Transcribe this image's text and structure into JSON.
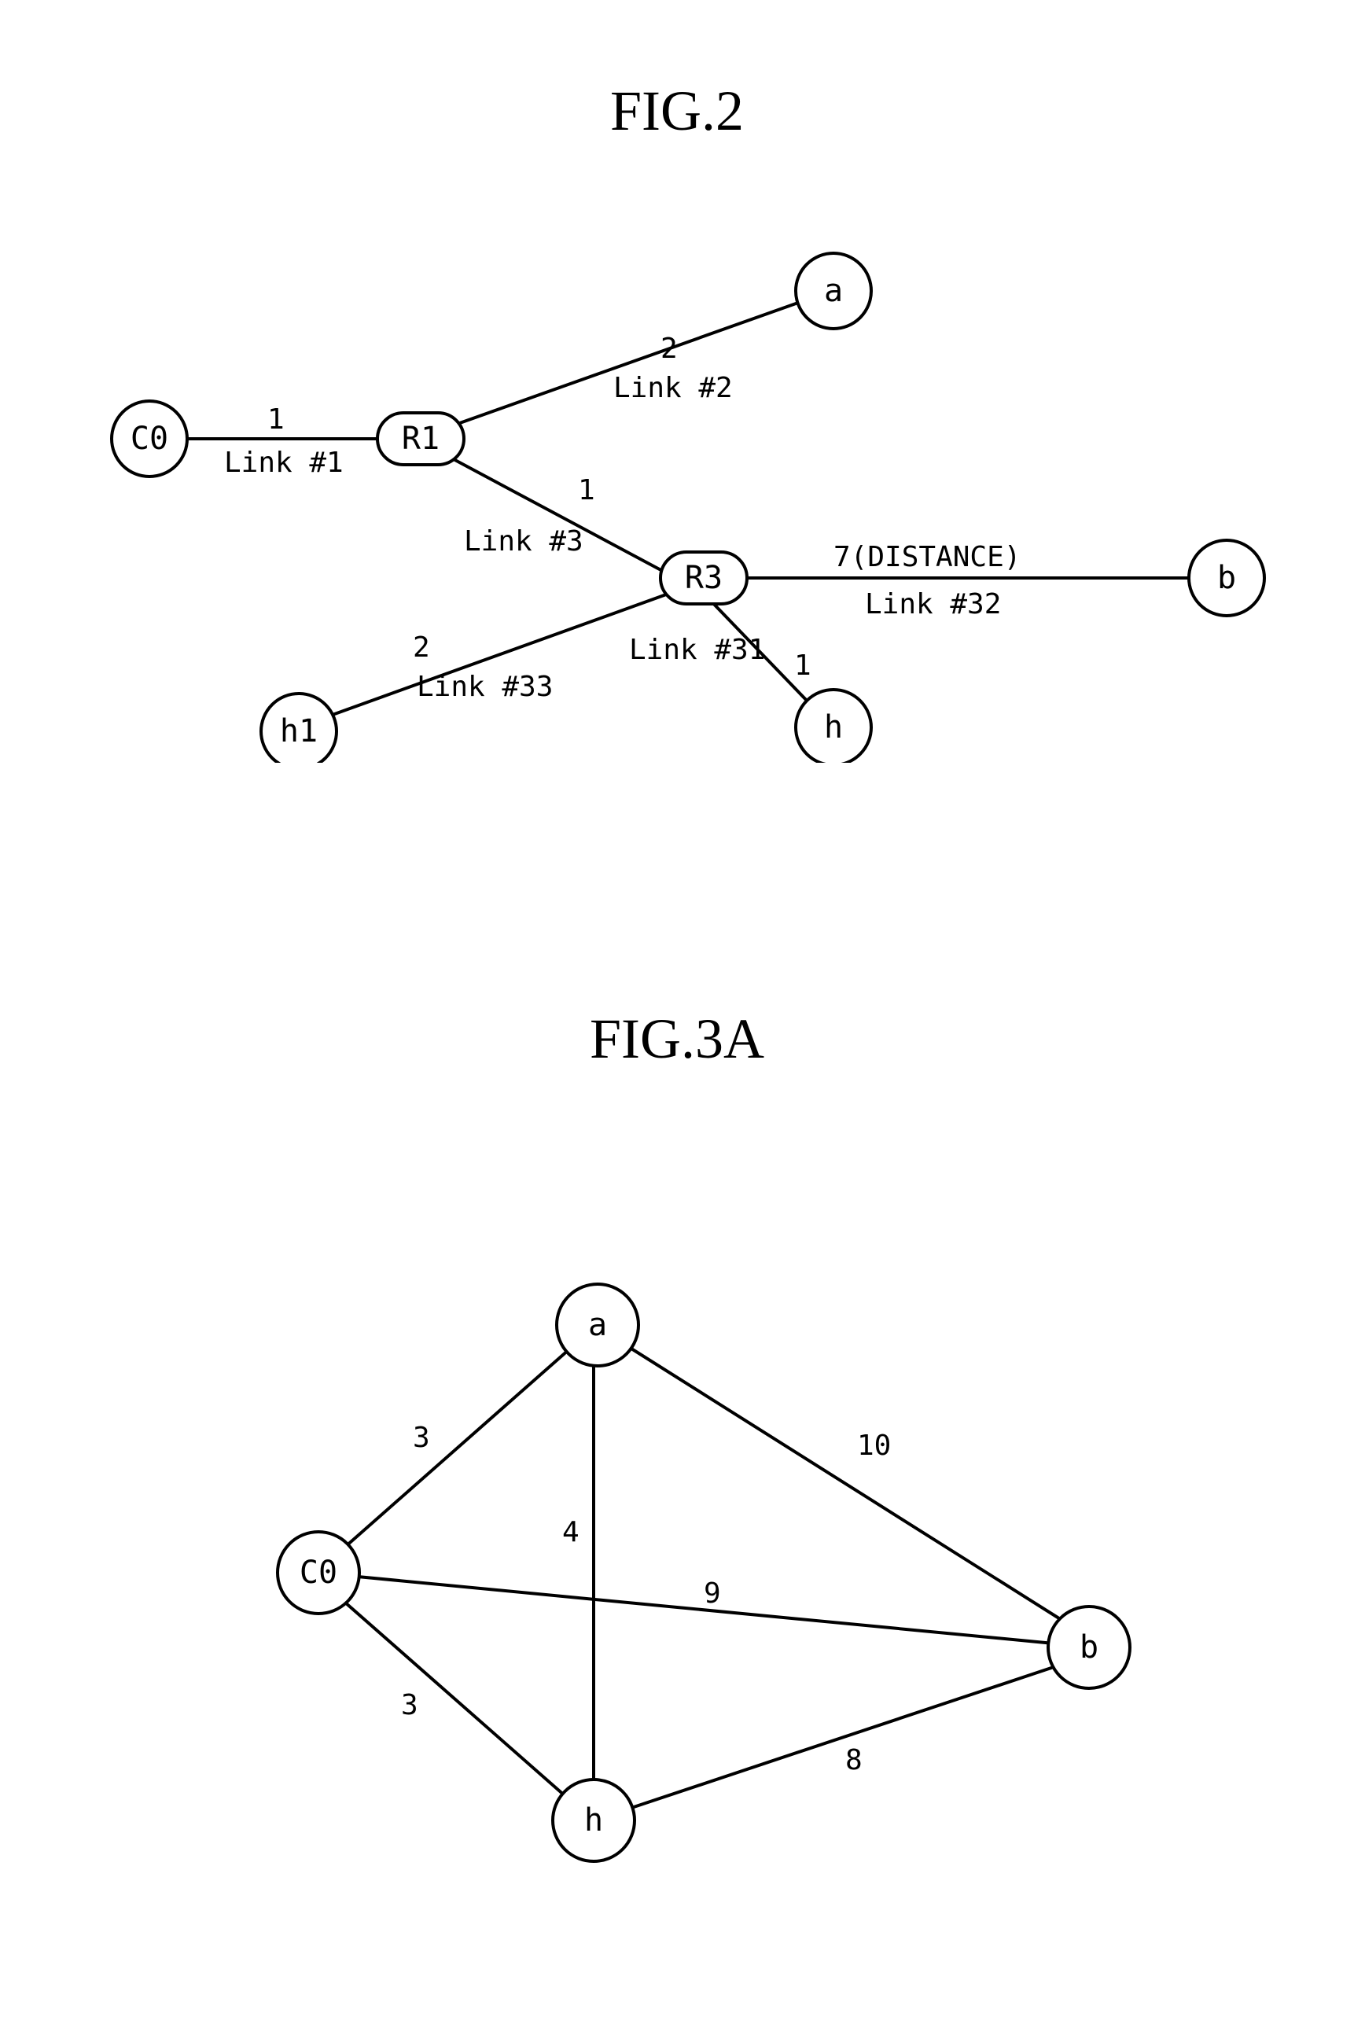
{
  "fig2": {
    "title": "FIG.2",
    "nodes": {
      "C0": "C0",
      "R1": "R1",
      "R3": "R3",
      "a": "a",
      "b": "b",
      "h": "h",
      "h1": "h1"
    },
    "links": {
      "link1": {
        "weight": "1",
        "label": "Link #1"
      },
      "link2": {
        "weight": "2",
        "label": "Link #2"
      },
      "link3": {
        "weight": "1",
        "label": "Link #3"
      },
      "link31": {
        "weight": "1",
        "label": "Link #31"
      },
      "link32": {
        "weight": "7(DISTANCE)",
        "label": "Link #32"
      },
      "link33": {
        "weight": "2",
        "label": "Link #33"
      }
    }
  },
  "fig3a": {
    "title": "FIG.3A",
    "nodes": {
      "C0": "C0",
      "a": "a",
      "b": "b",
      "h": "h"
    },
    "edges": {
      "C0_a": "3",
      "C0_h": "3",
      "C0_b": "9",
      "a_h": "4",
      "a_b": "10",
      "h_b": "8"
    }
  }
}
